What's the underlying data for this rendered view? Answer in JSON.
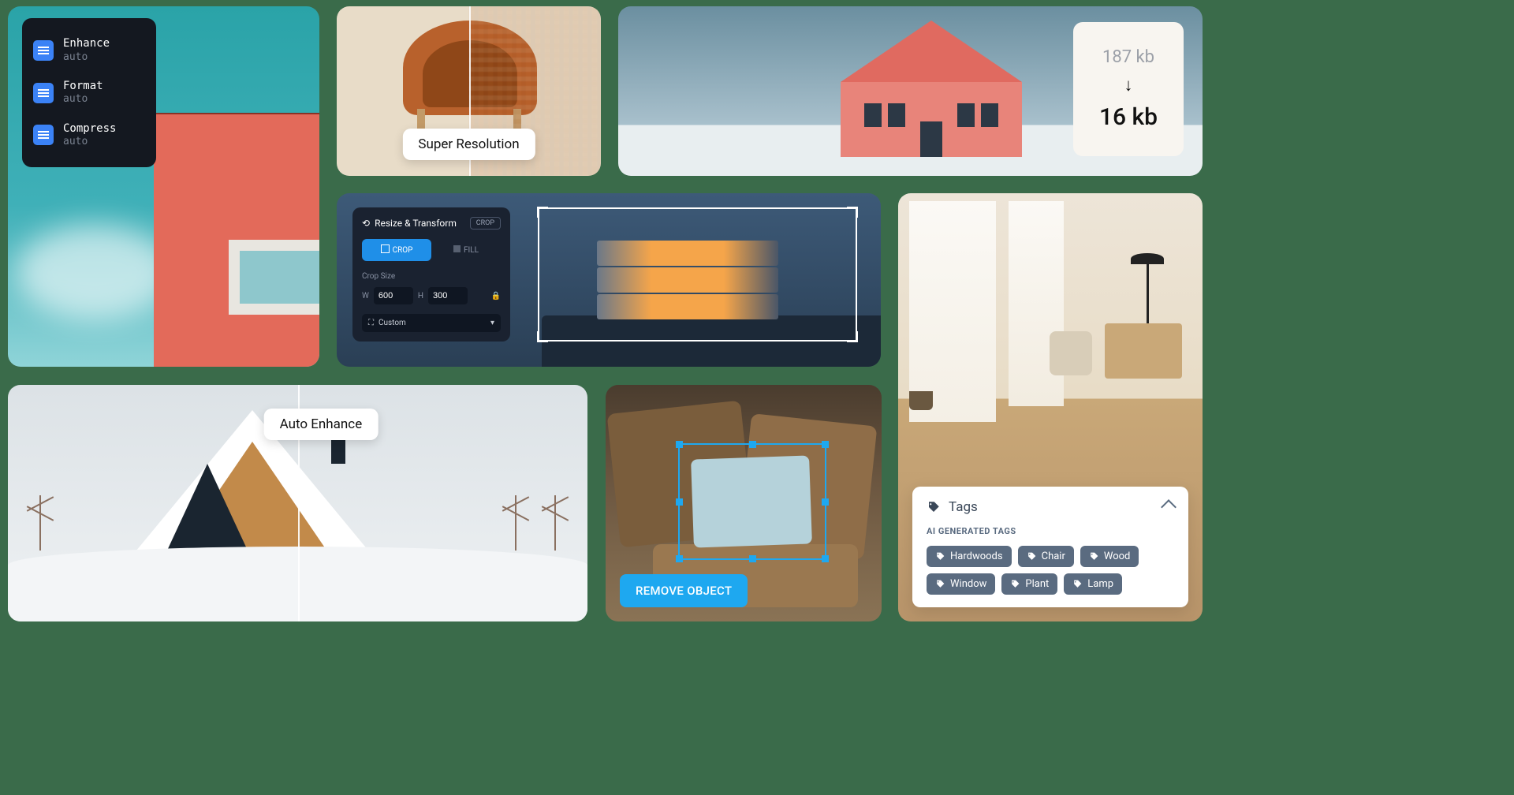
{
  "settings": {
    "items": [
      {
        "label": "Enhance",
        "value": "auto"
      },
      {
        "label": "Format",
        "value": "auto"
      },
      {
        "label": "Compress",
        "value": "auto"
      }
    ]
  },
  "super_res": {
    "label": "Super Resolution"
  },
  "compress": {
    "before": "187 kb",
    "after": "16 kb"
  },
  "crop": {
    "title": "Resize & Transform",
    "badge": "CROP",
    "tabs": {
      "crop": "CROP",
      "fill": "FILL"
    },
    "size_label": "Crop Size",
    "w_label": "W",
    "h_label": "H",
    "width": "600",
    "height": "300",
    "preset": "Custom"
  },
  "auto_enhance": {
    "label": "Auto Enhance"
  },
  "remove": {
    "button": "REMOVE OBJECT"
  },
  "tags": {
    "title": "Tags",
    "subtitle": "AI GENERATED TAGS",
    "items": [
      "Hardwoods",
      "Chair",
      "Wood",
      "Window",
      "Plant",
      "Lamp"
    ]
  }
}
